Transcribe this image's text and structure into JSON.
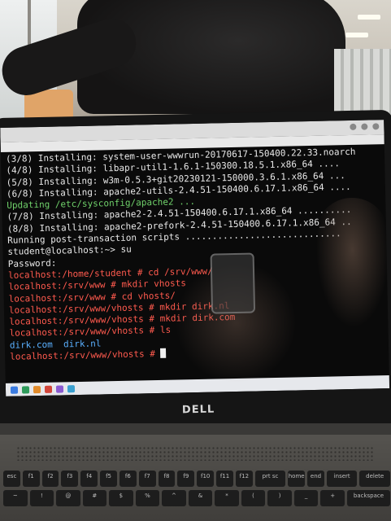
{
  "terminal": {
    "lines": [
      {
        "text": "(3/8) Installing: system-user-wwwrun-20170617-150400.22.33.noarch",
        "color": "white"
      },
      {
        "text": "(4/8) Installing: libapr-util1-1.6.1-150300.18.5.1.x86_64 ....",
        "color": "white"
      },
      {
        "text": "(5/8) Installing: w3m-0.5.3+git20230121-150000.3.6.1.x86_64 ...",
        "color": "white"
      },
      {
        "text": "(6/8) Installing: apache2-utils-2.4.51-150400.6.17.1.x86_64 ....",
        "color": "white"
      },
      {
        "text": "Updating /etc/sysconfig/apache2 ...",
        "color": "green"
      },
      {
        "text": "(7/8) Installing: apache2-2.4.51-150400.6.17.1.x86_64 ..........",
        "color": "white"
      },
      {
        "text": "(8/8) Installing: apache2-prefork-2.4.51-150400.6.17.1.x86_64 ..",
        "color": "white"
      },
      {
        "text": "Running post-transaction scripts .............................",
        "color": "white"
      },
      {
        "text": "student@localhost:~> su",
        "color": "white"
      },
      {
        "text": "Password:",
        "color": "white"
      },
      {
        "text": "localhost:/home/student # cd /srv/www/",
        "color": "red"
      },
      {
        "text": "localhost:/srv/www # mkdir vhosts",
        "color": "red"
      },
      {
        "text": "localhost:/srv/www # cd vhosts/",
        "color": "red"
      },
      {
        "text": "localhost:/srv/www/vhosts # mkdir dirk.nl",
        "color": "red"
      },
      {
        "text": "localhost:/srv/www/vhosts # mkdir dirk.com",
        "color": "red"
      },
      {
        "text": "localhost:/srv/www/vhosts # ls",
        "color": "red"
      },
      {
        "text": "dirk.com  dirk.nl",
        "color": "blue"
      },
      {
        "text": "localhost:/srv/www/vhosts # ",
        "color": "red"
      }
    ]
  },
  "laptop": {
    "brand": "DELL"
  },
  "keyboard": {
    "row1": [
      "esc",
      "f1",
      "f2",
      "f3",
      "f4",
      "f5",
      "f6",
      "f7",
      "f8",
      "f9",
      "f10",
      "f11",
      "f12",
      "prt sc",
      "home",
      "end",
      "insert",
      "delete"
    ],
    "row2": [
      "~",
      "!",
      "@",
      "#",
      "$",
      "%",
      "^",
      "&",
      "*",
      "(",
      ")",
      "_",
      "+",
      "backspace"
    ]
  },
  "colors": {
    "green": "#6fd06a",
    "red": "#ff5a4e",
    "blue": "#5ab0ff",
    "white": "#e8e8e8"
  }
}
